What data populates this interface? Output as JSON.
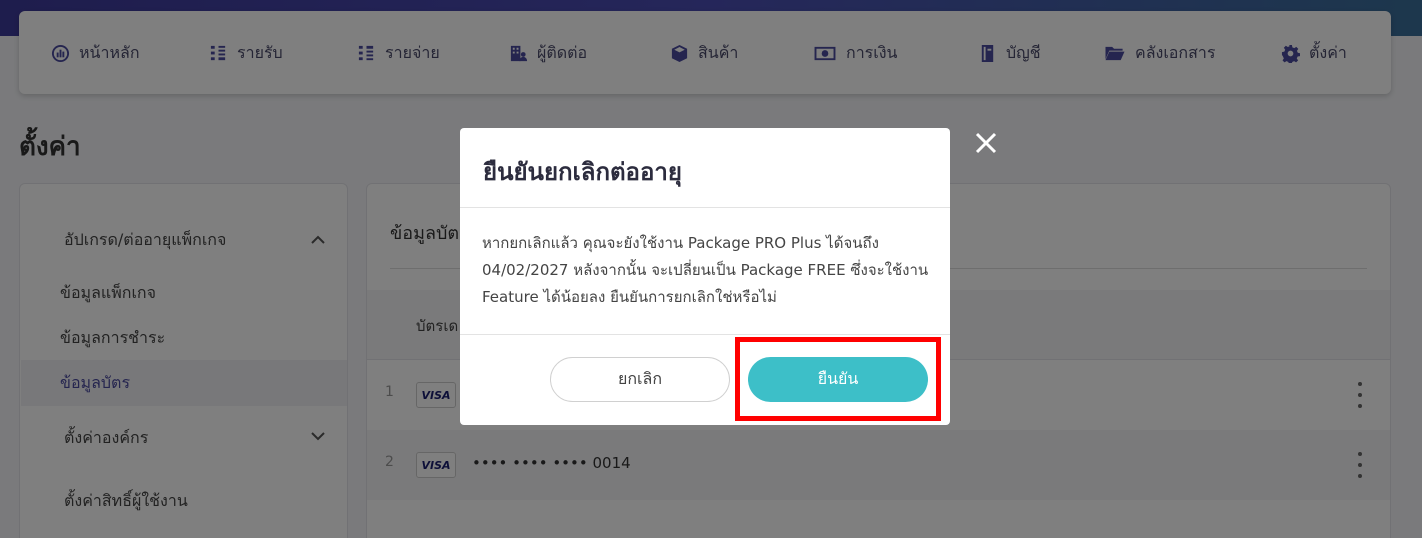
{
  "nav": {
    "items": [
      {
        "label": "หน้าหลัก",
        "icon": "dashboard-icon"
      },
      {
        "label": "รายรับ",
        "icon": "income-icon"
      },
      {
        "label": "รายจ่าย",
        "icon": "expense-icon"
      },
      {
        "label": "ผู้ติดต่อ",
        "icon": "contacts-icon"
      },
      {
        "label": "สินค้า",
        "icon": "box-icon"
      },
      {
        "label": "การเงิน",
        "icon": "money-icon"
      },
      {
        "label": "บัญชี",
        "icon": "book-icon"
      },
      {
        "label": "คลังเอกสาร",
        "icon": "folder-icon"
      },
      {
        "label": "ตั้งค่า",
        "icon": "gear-icon"
      }
    ]
  },
  "page": {
    "title": "ตั้งค่า"
  },
  "sidebar": {
    "section_upgrade": "อัปเกรด/ต่ออายุแพ็กเกจ",
    "items": [
      "ข้อมูลแพ็กเกจ",
      "ข้อมูลการชำระ",
      "ข้อมูลบัตร"
    ],
    "active_item": "ข้อมูลบัตร",
    "section_org": "ตั้งค่าองค์กร",
    "section_permissions": "ตั้งค่าสิทธิ์ผู้ใช้งาน"
  },
  "main": {
    "title": "ข้อมูลบัต",
    "column_card": "บัตรเด",
    "rows": [
      {
        "num": "1",
        "brand": "VISA",
        "card": ""
      },
      {
        "num": "2",
        "brand": "VISA",
        "card": "•••• •••• •••• 0014"
      }
    ]
  },
  "modal": {
    "title": "ยืนยันยกเลิกต่ออายุ",
    "body": "หากยกเลิกแล้ว คุณจะยังใช้งาน Package PRO Plus ได้จนถึง 04/02/2027 หลังจากนั้น จะเปลี่ยนเป็น Package FREE ซึ่งจะใช้งาน Feature ได้น้อยลง ยืนยันการยกเลิกใช่หรือไม่",
    "cancel_label": "ยกเลิก",
    "confirm_label": "ยืนยัน"
  },
  "colors": {
    "brand": "#4b4a9e",
    "confirm": "#3dbfc8",
    "highlight": "#ff0000"
  }
}
